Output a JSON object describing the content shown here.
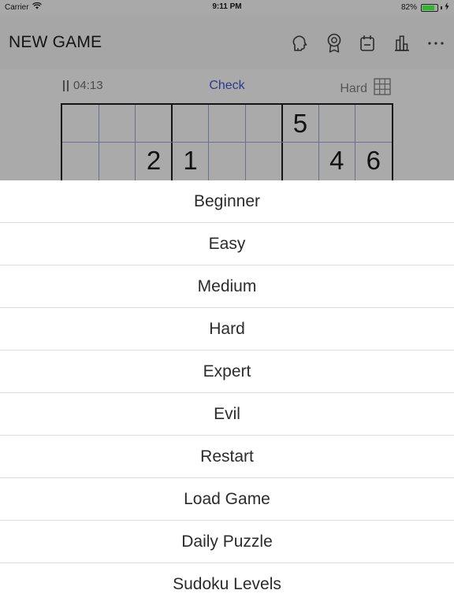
{
  "status": {
    "carrier": "Carrier",
    "time": "9:11 PM",
    "battery": "82%",
    "battery_level": 0.82
  },
  "nav": {
    "title": "NEW GAME",
    "icons": [
      "hint-icon",
      "award-icon",
      "calendar-icon",
      "stats-icon",
      "more-icon"
    ]
  },
  "toolbar": {
    "pause_icon": "pause-icon",
    "timer": "04:13",
    "check": "Check",
    "difficulty": "Hard",
    "grid_icon": "grid-icon"
  },
  "board": {
    "rows": [
      [
        "",
        "",
        "",
        "",
        "",
        "",
        "5",
        "",
        ""
      ],
      [
        "",
        "",
        "2",
        "1",
        "",
        "",
        "",
        "4",
        "6"
      ]
    ]
  },
  "menu": {
    "items": [
      "Beginner",
      "Easy",
      "Medium",
      "Hard",
      "Expert",
      "Evil",
      "Restart",
      "Load Game",
      "Daily Puzzle",
      "Sudoku Levels"
    ]
  }
}
